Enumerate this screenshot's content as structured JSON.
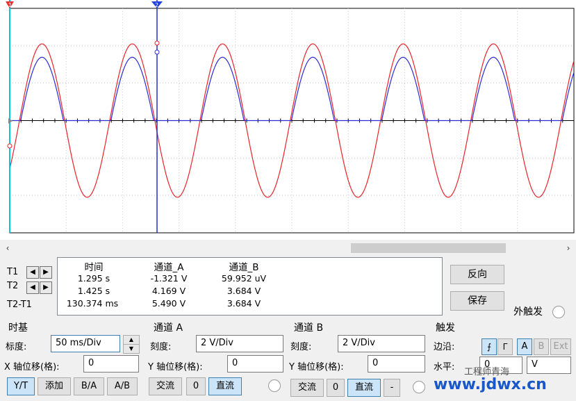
{
  "readout": {
    "headers": [
      "时间",
      "通道_A",
      "通道_B"
    ],
    "rows": [
      {
        "label": "T1",
        "time": "1.295 s",
        "a": "-1.321 V",
        "b": "59.952 uV"
      },
      {
        "label": "T2",
        "time": "1.425 s",
        "a": "4.169 V",
        "b": "3.684 V"
      },
      {
        "label": "T2-T1",
        "time": "130.374 ms",
        "a": "5.490 V",
        "b": "3.684 V"
      }
    ]
  },
  "cursor_arrows": {
    "left": "◀",
    "right": "▶"
  },
  "buttons": {
    "reverse": "反向",
    "save": "保存"
  },
  "ext_trigger_label": "外触发",
  "timebase": {
    "title": "时基",
    "scale_label": "标度:",
    "scale_value": "50 ms/Div",
    "xpos_label": "X 轴位移(格):",
    "xpos_value": "0",
    "modes": [
      "Y/T",
      "添加",
      "B/A",
      "A/B"
    ]
  },
  "channel_a": {
    "title": "通道 A",
    "scale_label": "刻度:",
    "scale_value": "2  V/Div",
    "ypos_label": "Y 轴位移(格):",
    "ypos_value": "0",
    "coupling": [
      "交流",
      "0",
      "直流"
    ]
  },
  "channel_b": {
    "title": "通道 B",
    "scale_label": "刻度:",
    "scale_value": "2  V/Div",
    "ypos_label": "Y 轴位移(格):",
    "ypos_value": "0",
    "coupling": [
      "交流",
      "0",
      "直流",
      "-"
    ]
  },
  "trigger": {
    "title": "触发",
    "edge_label": "边沿:",
    "edge_rising": "⨍",
    "edge_falling": "ᒥ",
    "sources": [
      "A",
      "B",
      "Ext"
    ],
    "level_label": "水平:",
    "level_value": "0",
    "level_unit": "V"
  },
  "cursor_markers": {
    "t1": "1",
    "t2": "2"
  },
  "watermark": "www.jdwx.cn",
  "watermark_text": "工程师青海",
  "colors": {
    "channel_a": "#e8232b",
    "channel_b": "#2b2bd6",
    "cursor_t1": "#00c8d8",
    "cursor_t2": "#2030c0"
  },
  "chart_data": {
    "type": "line",
    "series": [
      {
        "name": "",
        "waveform": "sine",
        "amplitude_div": 2.05,
        "period_div": 1.6
      },
      {
        "name": "",
        "waveform": "half-clipped sine",
        "amplitude_div": 1.84,
        "period_div": 1.6
      }
    ],
    "grid": true
  }
}
